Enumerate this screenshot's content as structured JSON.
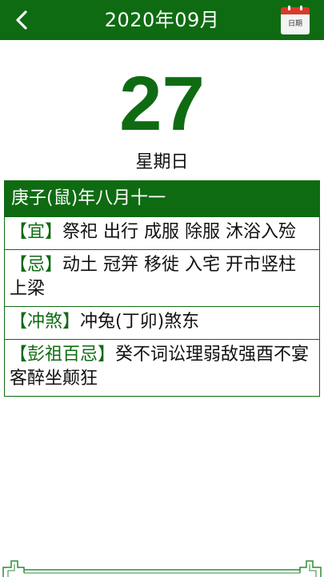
{
  "header": {
    "title": "2020年09月",
    "calendar_button_label": "日期"
  },
  "date": {
    "day": "27",
    "weekday": "星期日"
  },
  "lunar": "庚子(鼠)年八月十一",
  "rows": [
    {
      "tag": "【宜】",
      "text": "祭祀 出行 成服 除服 沐浴入殓"
    },
    {
      "tag": "【忌】",
      "text": "动土 冠笄 移徙 入宅 开市竖柱 上梁"
    },
    {
      "tag": "【冲煞】",
      "text": "冲兔(丁卯)煞东"
    },
    {
      "tag": "【彭祖百忌】",
      "text": "癸不词讼理弱敌强酉不宴客醉坐颠狂"
    }
  ],
  "colors": {
    "primary": "#0f6b12",
    "calendar_red": "#d83a2b"
  }
}
